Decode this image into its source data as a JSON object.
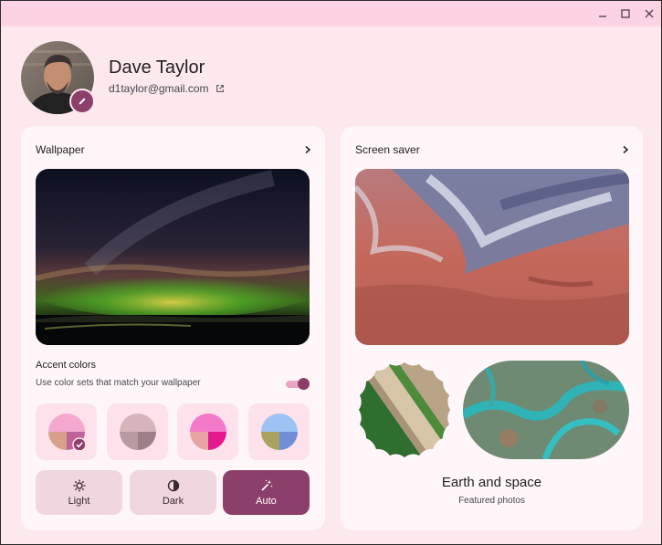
{
  "window": {
    "controls": [
      "minimize",
      "maximize",
      "close"
    ]
  },
  "user": {
    "name": "Dave Taylor",
    "email": "d1taylor@gmail.com"
  },
  "wallpaper": {
    "title": "Wallpaper"
  },
  "accent": {
    "title": "Accent colors",
    "subtitle": "Use color sets that match your wallpaper",
    "toggle_on": true,
    "swatches": [
      {
        "colors": [
          "#f4a7cf",
          "#d89f8a",
          "#c0629a"
        ],
        "selected": true
      },
      {
        "colors": [
          "#d5b4bc",
          "#b89aa2",
          "#9f7f87"
        ],
        "selected": false
      },
      {
        "colors": [
          "#f479c9",
          "#e8a3a3",
          "#e4198e"
        ],
        "selected": false
      },
      {
        "colors": [
          "#9dc3f5",
          "#a8a45d",
          "#6e8fd6"
        ],
        "selected": false
      }
    ]
  },
  "modes": [
    {
      "label": "Light",
      "icon": "gear-sun-icon",
      "active": false
    },
    {
      "label": "Dark",
      "icon": "half-circle-icon",
      "active": false
    },
    {
      "label": "Auto",
      "icon": "magic-wand-icon",
      "active": true
    }
  ],
  "screensaver": {
    "title": "Screen saver",
    "collection_title": "Earth and space",
    "collection_subtitle": "Featured photos"
  },
  "colors": {
    "accent": "#8b3f6a",
    "background": "#fde8ee",
    "titlebar": "#fcd3e3",
    "card": "#fff6fa"
  }
}
